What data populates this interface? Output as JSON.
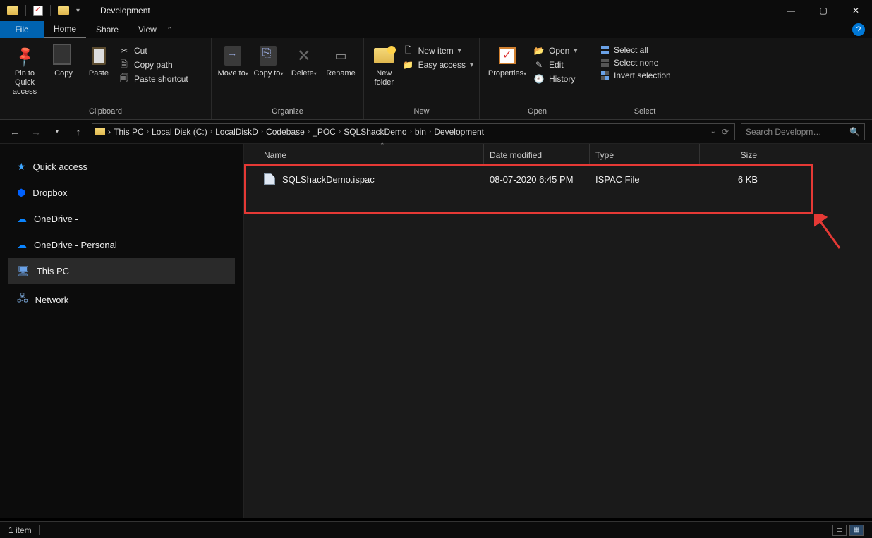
{
  "window": {
    "title": "Development"
  },
  "menu": {
    "file": "File",
    "tabs": [
      "Home",
      "Share",
      "View"
    ],
    "active_tab": 0
  },
  "ribbon": {
    "clipboard": {
      "label": "Clipboard",
      "pin": "Pin to Quick access",
      "copy": "Copy",
      "paste": "Paste",
      "cut": "Cut",
      "copy_path": "Copy path",
      "paste_shortcut": "Paste shortcut"
    },
    "organize": {
      "label": "Organize",
      "move_to": "Move to",
      "copy_to": "Copy to",
      "delete": "Delete",
      "rename": "Rename"
    },
    "new": {
      "label": "New",
      "new_folder": "New folder",
      "new_item": "New item",
      "easy_access": "Easy access"
    },
    "open": {
      "label": "Open",
      "properties": "Properties",
      "open": "Open",
      "edit": "Edit",
      "history": "History"
    },
    "select": {
      "label": "Select",
      "select_all": "Select all",
      "select_none": "Select none",
      "invert": "Invert selection"
    }
  },
  "breadcrumbs": [
    "This PC",
    "Local Disk (C:)",
    "LocalDiskD",
    "Codebase",
    "_POC",
    "SQLShackDemo",
    "bin",
    "Development"
  ],
  "search": {
    "placeholder": "Search Developm…"
  },
  "sidebar": {
    "items": [
      {
        "label": "Quick access",
        "icon": "star"
      },
      {
        "label": "Dropbox",
        "icon": "dropbox"
      },
      {
        "label": "OneDrive -",
        "icon": "cloud"
      },
      {
        "label": "OneDrive - Personal",
        "icon": "cloud"
      },
      {
        "label": "This PC",
        "icon": "pc",
        "selected": true
      },
      {
        "label": "Network",
        "icon": "net"
      }
    ]
  },
  "columns": {
    "name": "Name",
    "modified": "Date modified",
    "type": "Type",
    "size": "Size"
  },
  "files": [
    {
      "name": "SQLShackDemo.ispac",
      "modified": "08-07-2020 6:45 PM",
      "type": "ISPAC File",
      "size": "6 KB"
    }
  ],
  "status": {
    "count": "1 item"
  }
}
